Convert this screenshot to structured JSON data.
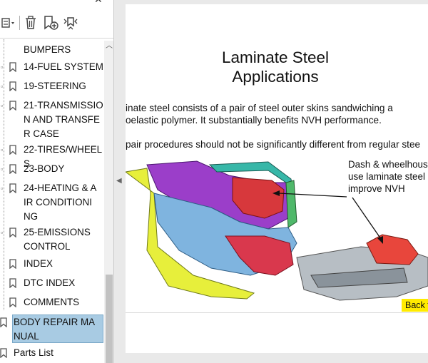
{
  "panel": {
    "toolbar": {
      "options_icon": "options-menu-icon",
      "delete_icon": "trash-icon",
      "new_bookmark_icon": "new-bookmark-icon",
      "expand_icon": "expand-bookmark-icon"
    },
    "bookmarks": [
      {
        "label": "BUMPERS"
      },
      {
        "label": "14-FUEL SYSTEM"
      },
      {
        "label": "19-STEERING"
      },
      {
        "label": "21-TRANSMISSION AND TRANSFER CASE"
      },
      {
        "label": "22-TIRES/WHEELS"
      },
      {
        "label": "23-BODY"
      },
      {
        "label": "24-HEATING & AIR CONDITIONING"
      },
      {
        "label": "25-EMISSIONS CONTROL"
      },
      {
        "label": "INDEX"
      },
      {
        "label": "DTC INDEX"
      },
      {
        "label": "COMMENTS"
      },
      {
        "label": "BODY REPAIR MANUAL"
      },
      {
        "label": "Parts List"
      }
    ]
  },
  "page": {
    "title_line1": "Laminate Steel",
    "title_line2": "Applications",
    "para1_line1": "inate steel consists of a pair of steel outer skins sandwiching a",
    "para1_line2": "oelastic polymer. It substantially benefits NVH performance.",
    "para2": "pair procedures should not be significantly different from regular stee",
    "callout_line1": "Dash & wheelhous",
    "callout_line2": "use laminate steel",
    "callout_line3": "improve NVH",
    "back_button": "Back t"
  },
  "colors": {
    "selected_bookmark": "#a8cbe3",
    "back_button": "#ffeb00"
  }
}
